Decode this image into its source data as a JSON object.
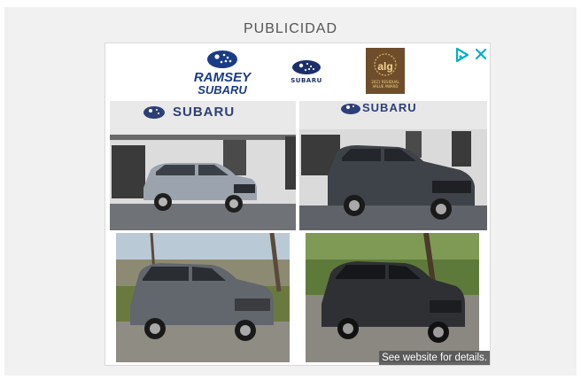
{
  "ad_label": "PUBLICIDAD",
  "logos": {
    "dealer_line1": "RAMSEY",
    "dealer_line2": "SUBARU",
    "brand": "SUBARU",
    "award_mark": "alg",
    "award_text": "2021 RESIDUAL VALUE AWARD"
  },
  "photos": {
    "sign_1": "SUBARU",
    "sign_2": "SUBARU"
  },
  "disclaimer": "See website for details.",
  "icons": {
    "adchoices": "adchoices-icon",
    "close": "close-icon"
  },
  "colors": {
    "adchoices_blue": "#00aecd",
    "subaru_blue": "#1a3c86"
  }
}
